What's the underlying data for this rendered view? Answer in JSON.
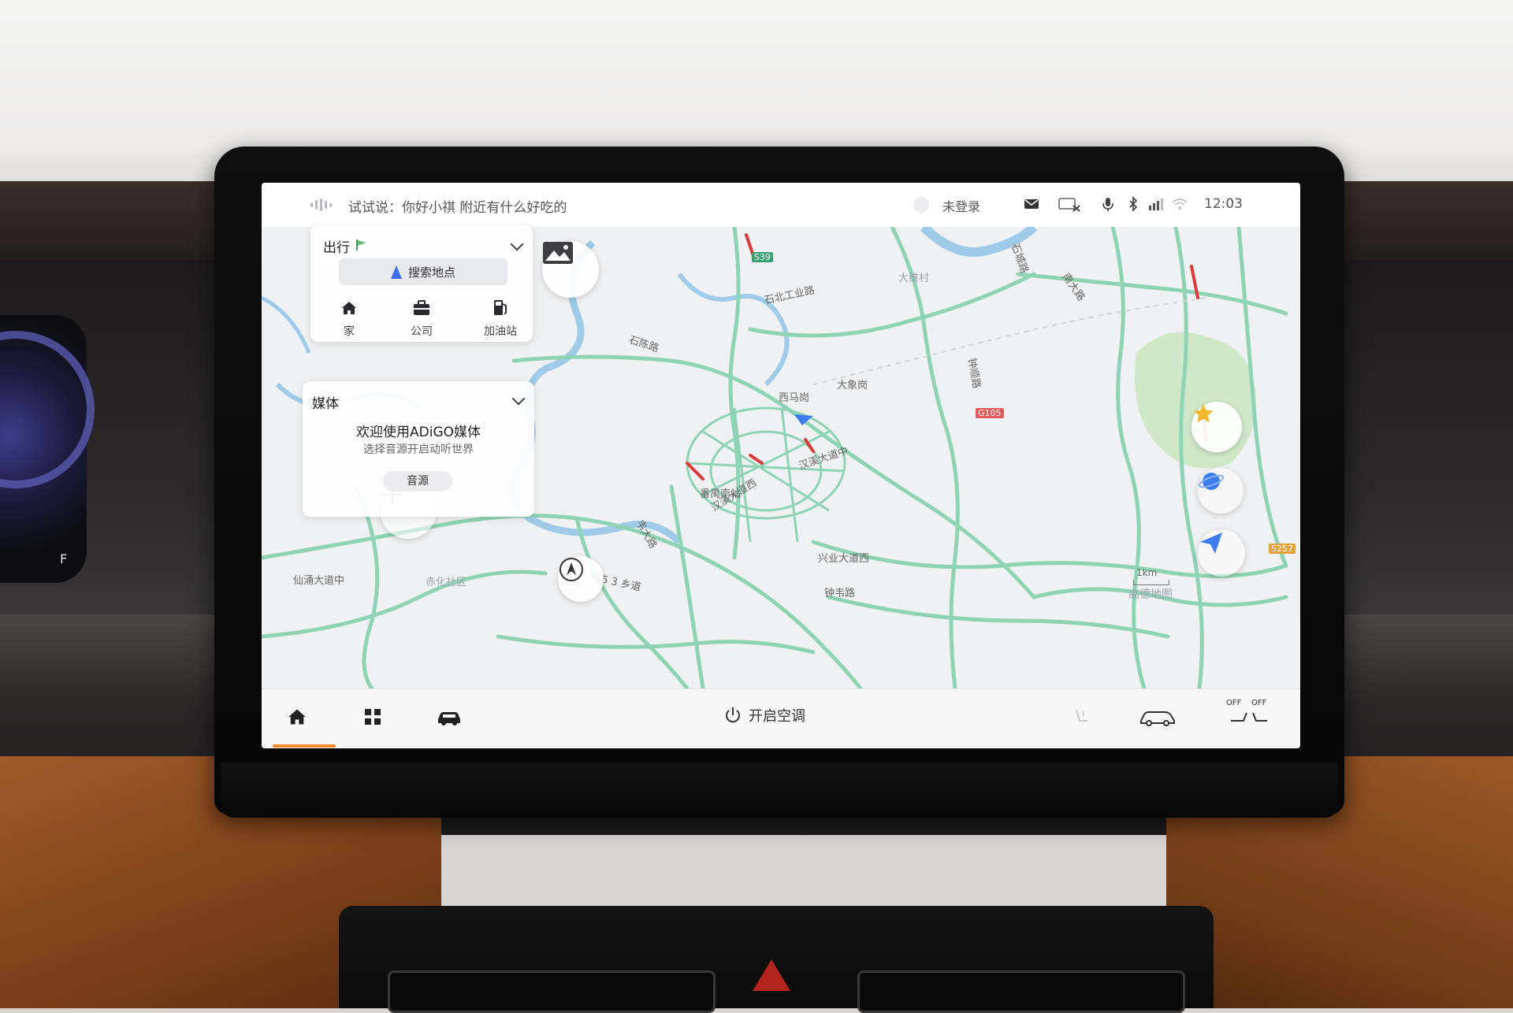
{
  "status_bar": {
    "voice_hint": "试试说：你好小祺 附近有什么好吃的",
    "login": "未登录",
    "time": "12:03"
  },
  "travel_card": {
    "title": "出行",
    "search_label": "搜索地点",
    "quick": [
      {
        "label": "家",
        "icon": "home-icon"
      },
      {
        "label": "公司",
        "icon": "briefcase-icon"
      },
      {
        "label": "加油站",
        "icon": "fuel-pump-icon"
      }
    ]
  },
  "media_card": {
    "title": "媒体",
    "welcome": "欢迎使用ADiGO媒体",
    "subtitle": "选择音源开启动听世界",
    "source_button": "音源"
  },
  "map": {
    "labels": {
      "shibei": "石北工业路",
      "shichen": "石陈路",
      "hanxi_mid": "汉溪大道中",
      "hanxi_west": "汉溪大道西",
      "xingye": "兴业大道西",
      "zhongwei": "钟韦路",
      "xianyong": "仙涌大道中",
      "m53": "M 5 3 乡道",
      "weidalu": "韦大路",
      "daxiang": "大象岗",
      "ximagang": "西马岗",
      "zhongshun": "钟顺路",
      "scale": "1km",
      "g105": "G105",
      "s39": "S39",
      "s257": "S257",
      "gaode": "高德地图",
      "nandatong": "南大路",
      "shicheng": "石城路",
      "daweicun": "大维村",
      "xihua": "赤化社区",
      "fanyu": "番禺南站"
    },
    "colors": {
      "road": "#8fd3b6",
      "water": "#9fcbe8",
      "park": "#cfe8c8",
      "jam": "#d93a3a",
      "nav": "#3d7df0"
    }
  },
  "dock": {
    "ac_label": "开启空调",
    "off_left": "OFF",
    "off_right": "OFF"
  }
}
